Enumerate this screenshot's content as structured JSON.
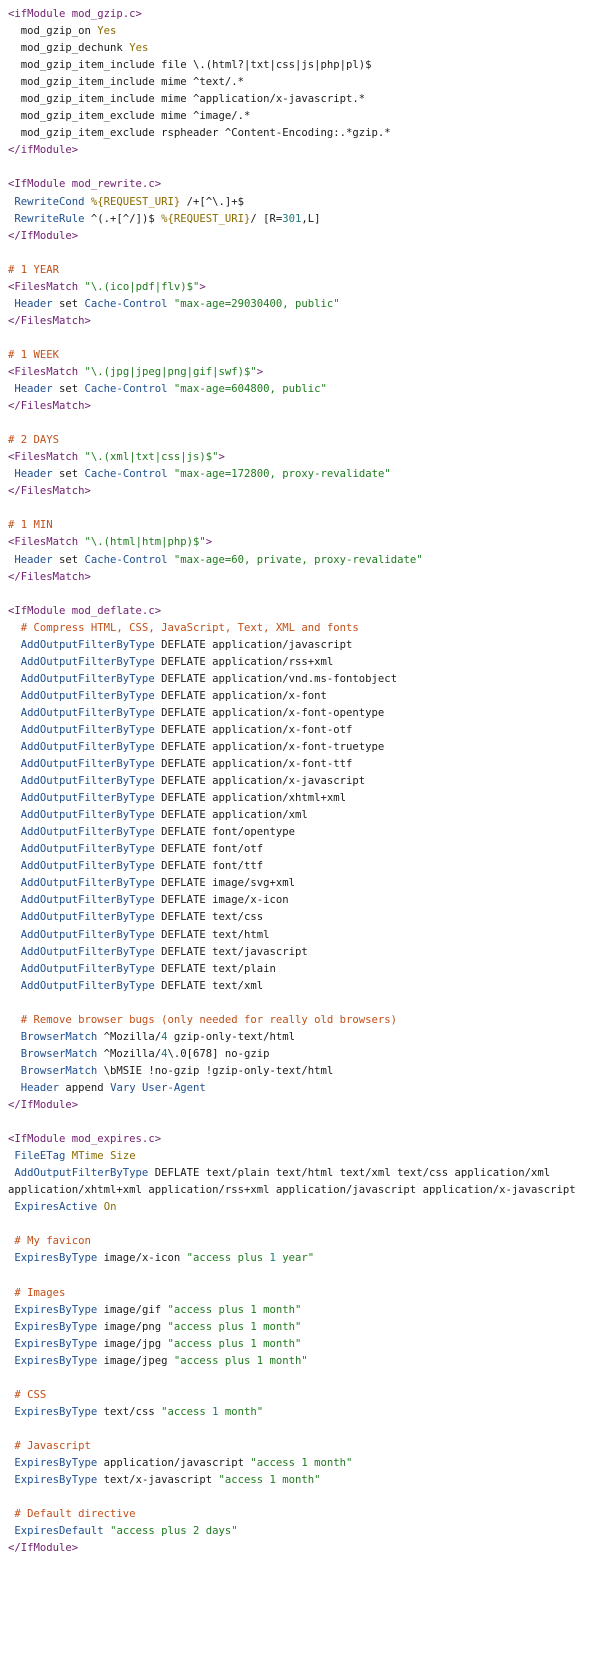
{
  "colors": {
    "tag": "#6f1f6f",
    "directive": "#1f4f8f",
    "comment": "#c0501a",
    "string": "#1f7a1f",
    "value": "#8a6a00",
    "number": "#1c7a7a",
    "text": "#1a1a1a",
    "background": "#ffffff"
  },
  "lines": [
    [
      [
        "tag",
        "<ifModule mod_gzip.c>"
      ]
    ],
    [
      [
        "text",
        "  mod_gzip_on "
      ],
      [
        "value",
        "Yes"
      ]
    ],
    [
      [
        "text",
        "  mod_gzip_dechunk "
      ],
      [
        "value",
        "Yes"
      ]
    ],
    [
      [
        "text",
        "  mod_gzip_item_include file \\.(html?|txt|css|js|php|pl)$"
      ]
    ],
    [
      [
        "text",
        "  mod_gzip_item_include mime ^text/.*"
      ]
    ],
    [
      [
        "text",
        "  mod_gzip_item_include mime ^application/x-javascript.*"
      ]
    ],
    [
      [
        "text",
        "  mod_gzip_item_exclude mime ^image/.*"
      ]
    ],
    [
      [
        "text",
        "  mod_gzip_item_exclude rspheader ^Content-Encoding:.*gzip.*"
      ]
    ],
    [
      [
        "tag",
        "</ifModule>"
      ]
    ],
    [],
    [
      [
        "tag",
        "<IfModule mod_rewrite.c>"
      ]
    ],
    [
      [
        "dir",
        " RewriteCond "
      ],
      [
        "value",
        "%{REQUEST_URI}"
      ],
      [
        "text",
        " /+[^\\.]+$"
      ]
    ],
    [
      [
        "dir",
        " RewriteRule "
      ],
      [
        "text",
        "^(.+[^/])$ "
      ],
      [
        "value",
        "%{REQUEST_URI}"
      ],
      [
        "text",
        "/ [R="
      ],
      [
        "number",
        "301"
      ],
      [
        "text",
        ",L]"
      ]
    ],
    [
      [
        "tag",
        "</IfModule>"
      ]
    ],
    [],
    [
      [
        "comment",
        "# 1 YEAR"
      ]
    ],
    [
      [
        "tag",
        "<FilesMatch "
      ],
      [
        "string",
        "\"\\.(ico|pdf|flv)$\""
      ],
      [
        "tag",
        ">"
      ]
    ],
    [
      [
        "dir",
        " Header"
      ],
      [
        "text",
        " set "
      ],
      [
        "dir",
        "Cache-Control"
      ],
      [
        "text",
        " "
      ],
      [
        "string",
        "\"max-age=29030400, public\""
      ]
    ],
    [
      [
        "tag",
        "</FilesMatch>"
      ]
    ],
    [],
    [
      [
        "comment",
        "# 1 WEEK"
      ]
    ],
    [
      [
        "tag",
        "<FilesMatch "
      ],
      [
        "string",
        "\"\\.(jpg|jpeg|png|gif|swf)$\""
      ],
      [
        "tag",
        ">"
      ]
    ],
    [
      [
        "dir",
        " Header"
      ],
      [
        "text",
        " set "
      ],
      [
        "dir",
        "Cache-Control"
      ],
      [
        "text",
        " "
      ],
      [
        "string",
        "\"max-age=604800, public\""
      ]
    ],
    [
      [
        "tag",
        "</FilesMatch>"
      ]
    ],
    [],
    [
      [
        "comment",
        "# 2 DAYS"
      ]
    ],
    [
      [
        "tag",
        "<FilesMatch "
      ],
      [
        "string",
        "\"\\.(xml|txt|css|js)$\""
      ],
      [
        "tag",
        ">"
      ]
    ],
    [
      [
        "dir",
        " Header"
      ],
      [
        "text",
        " set "
      ],
      [
        "dir",
        "Cache-Control"
      ],
      [
        "text",
        " "
      ],
      [
        "string",
        "\"max-age=172800, proxy-revalidate\""
      ]
    ],
    [
      [
        "tag",
        "</FilesMatch>"
      ]
    ],
    [],
    [
      [
        "comment",
        "# 1 MIN"
      ]
    ],
    [
      [
        "tag",
        "<FilesMatch "
      ],
      [
        "string",
        "\"\\.(html|htm|php)$\""
      ],
      [
        "tag",
        ">"
      ]
    ],
    [
      [
        "dir",
        " Header"
      ],
      [
        "text",
        " set "
      ],
      [
        "dir",
        "Cache-Control"
      ],
      [
        "text",
        " "
      ],
      [
        "string",
        "\"max-age=60, private, proxy-revalidate\""
      ]
    ],
    [
      [
        "tag",
        "</FilesMatch>"
      ]
    ],
    [],
    [
      [
        "tag",
        "<IfModule mod_deflate.c>"
      ]
    ],
    [
      [
        "comment",
        "  # Compress HTML, CSS, JavaScript, Text, XML and fonts"
      ]
    ],
    [
      [
        "dir",
        "  AddOutputFilterByType"
      ],
      [
        "text",
        " DEFLATE application/javascript"
      ]
    ],
    [
      [
        "dir",
        "  AddOutputFilterByType"
      ],
      [
        "text",
        " DEFLATE application/rss+xml"
      ]
    ],
    [
      [
        "dir",
        "  AddOutputFilterByType"
      ],
      [
        "text",
        " DEFLATE application/vnd.ms-fontobject"
      ]
    ],
    [
      [
        "dir",
        "  AddOutputFilterByType"
      ],
      [
        "text",
        " DEFLATE application/x-font"
      ]
    ],
    [
      [
        "dir",
        "  AddOutputFilterByType"
      ],
      [
        "text",
        " DEFLATE application/x-font-opentype"
      ]
    ],
    [
      [
        "dir",
        "  AddOutputFilterByType"
      ],
      [
        "text",
        " DEFLATE application/x-font-otf"
      ]
    ],
    [
      [
        "dir",
        "  AddOutputFilterByType"
      ],
      [
        "text",
        " DEFLATE application/x-font-truetype"
      ]
    ],
    [
      [
        "dir",
        "  AddOutputFilterByType"
      ],
      [
        "text",
        " DEFLATE application/x-font-ttf"
      ]
    ],
    [
      [
        "dir",
        "  AddOutputFilterByType"
      ],
      [
        "text",
        " DEFLATE application/x-javascript"
      ]
    ],
    [
      [
        "dir",
        "  AddOutputFilterByType"
      ],
      [
        "text",
        " DEFLATE application/xhtml+xml"
      ]
    ],
    [
      [
        "dir",
        "  AddOutputFilterByType"
      ],
      [
        "text",
        " DEFLATE application/xml"
      ]
    ],
    [
      [
        "dir",
        "  AddOutputFilterByType"
      ],
      [
        "text",
        " DEFLATE font/opentype"
      ]
    ],
    [
      [
        "dir",
        "  AddOutputFilterByType"
      ],
      [
        "text",
        " DEFLATE font/otf"
      ]
    ],
    [
      [
        "dir",
        "  AddOutputFilterByType"
      ],
      [
        "text",
        " DEFLATE font/ttf"
      ]
    ],
    [
      [
        "dir",
        "  AddOutputFilterByType"
      ],
      [
        "text",
        " DEFLATE image/svg+xml"
      ]
    ],
    [
      [
        "dir",
        "  AddOutputFilterByType"
      ],
      [
        "text",
        " DEFLATE image/x-icon"
      ]
    ],
    [
      [
        "dir",
        "  AddOutputFilterByType"
      ],
      [
        "text",
        " DEFLATE text/css"
      ]
    ],
    [
      [
        "dir",
        "  AddOutputFilterByType"
      ],
      [
        "text",
        " DEFLATE text/html"
      ]
    ],
    [
      [
        "dir",
        "  AddOutputFilterByType"
      ],
      [
        "text",
        " DEFLATE text/javascript"
      ]
    ],
    [
      [
        "dir",
        "  AddOutputFilterByType"
      ],
      [
        "text",
        " DEFLATE text/plain"
      ]
    ],
    [
      [
        "dir",
        "  AddOutputFilterByType"
      ],
      [
        "text",
        " DEFLATE text/xml"
      ]
    ],
    [],
    [
      [
        "comment",
        "  # Remove browser bugs (only needed for really old browsers)"
      ]
    ],
    [
      [
        "dir",
        "  BrowserMatch"
      ],
      [
        "text",
        " ^Mozilla/"
      ],
      [
        "number",
        "4"
      ],
      [
        "text",
        " gzip-only-text/html"
      ]
    ],
    [
      [
        "dir",
        "  BrowserMatch"
      ],
      [
        "text",
        " ^Mozilla/"
      ],
      [
        "number",
        "4"
      ],
      [
        "text",
        "\\.0[678] no-gzip"
      ]
    ],
    [
      [
        "dir",
        "  BrowserMatch"
      ],
      [
        "text",
        " \\bMSIE !no-gzip !gzip-only-text/html"
      ]
    ],
    [
      [
        "dir",
        "  Header"
      ],
      [
        "text",
        " append "
      ],
      [
        "dir",
        "Vary"
      ],
      [
        "text",
        " "
      ],
      [
        "dir",
        "User-Agent"
      ]
    ],
    [
      [
        "tag",
        "</IfModule>"
      ]
    ],
    [],
    [
      [
        "tag",
        "<IfModule mod_expires.c>"
      ]
    ],
    [
      [
        "dir",
        " FileETag"
      ],
      [
        "text",
        " "
      ],
      [
        "value",
        "MTime Size"
      ]
    ],
    [
      [
        "dir",
        " AddOutputFilterByType"
      ],
      [
        "text",
        " DEFLATE text/plain text/html text/xml text/css application/xml"
      ]
    ],
    [
      [
        "text",
        "application/xhtml+xml application/rss+xml application/javascript application/x-javascript"
      ]
    ],
    [
      [
        "dir",
        " ExpiresActive"
      ],
      [
        "text",
        " "
      ],
      [
        "value",
        "On"
      ]
    ],
    [],
    [
      [
        "comment",
        " # My favicon"
      ]
    ],
    [
      [
        "dir",
        " ExpiresByType"
      ],
      [
        "text",
        " image/x-icon "
      ],
      [
        "string",
        "\"access plus "
      ],
      [
        "number",
        "1"
      ],
      [
        "string",
        " year\""
      ]
    ],
    [],
    [
      [
        "comment",
        " # Images"
      ]
    ],
    [
      [
        "dir",
        " ExpiresByType"
      ],
      [
        "text",
        " image/gif "
      ],
      [
        "string",
        "\"access plus 1 month\""
      ]
    ],
    [
      [
        "dir",
        " ExpiresByType"
      ],
      [
        "text",
        " image/png "
      ],
      [
        "string",
        "\"access plus 1 month\""
      ]
    ],
    [
      [
        "dir",
        " ExpiresByType"
      ],
      [
        "text",
        " image/jpg "
      ],
      [
        "string",
        "\"access plus 1 month\""
      ]
    ],
    [
      [
        "dir",
        " ExpiresByType"
      ],
      [
        "text",
        " image/jpeg "
      ],
      [
        "string",
        "\"access plus 1 month\""
      ]
    ],
    [],
    [
      [
        "comment",
        " # CSS"
      ]
    ],
    [
      [
        "dir",
        " ExpiresByType"
      ],
      [
        "text",
        " text/css "
      ],
      [
        "string",
        "\"access "
      ],
      [
        "number",
        "1"
      ],
      [
        "string",
        " month\""
      ]
    ],
    [],
    [
      [
        "comment",
        " # Javascript"
      ]
    ],
    [
      [
        "dir",
        " ExpiresByType"
      ],
      [
        "text",
        " application/javascript "
      ],
      [
        "string",
        "\"access 1 month\""
      ]
    ],
    [
      [
        "dir",
        " ExpiresByType"
      ],
      [
        "text",
        " text/x-javascript "
      ],
      [
        "string",
        "\"access 1 month\""
      ]
    ],
    [],
    [
      [
        "comment",
        " # Default directive"
      ]
    ],
    [
      [
        "dir",
        " ExpiresDefault"
      ],
      [
        "text",
        " "
      ],
      [
        "string",
        "\"access plus 2 days\""
      ]
    ],
    [
      [
        "tag",
        "</IfModule>"
      ]
    ]
  ]
}
